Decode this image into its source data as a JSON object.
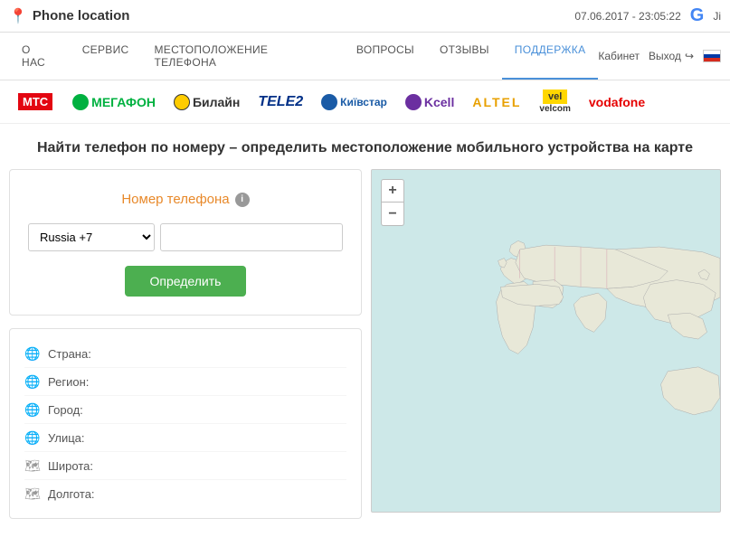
{
  "header": {
    "logo_text": "Phone location",
    "datetime": "07.06.2017 - 23:05:22",
    "google_label": "G Ji"
  },
  "nav": {
    "items": [
      {
        "id": "about",
        "label": "О НАС"
      },
      {
        "id": "service",
        "label": "СЕРВИС"
      },
      {
        "id": "location",
        "label": "МЕСТОПОЛОЖЕНИЕ ТЕЛЕФОНА"
      },
      {
        "id": "questions",
        "label": "ВОПРОСЫ"
      },
      {
        "id": "reviews",
        "label": "ОТЗЫВЫ"
      },
      {
        "id": "support",
        "label": "ПОДДЕРЖКА",
        "active": true
      }
    ],
    "cabinet_label": "Кабинет",
    "logout_label": "Выход"
  },
  "brands": [
    {
      "id": "mts",
      "label": "МТС"
    },
    {
      "id": "megafon",
      "label": "МЕГАФОН"
    },
    {
      "id": "beeline",
      "label": "Билайн"
    },
    {
      "id": "tele2",
      "label": "TELE2"
    },
    {
      "id": "kyivstar",
      "label": "Київстар"
    },
    {
      "id": "kcell",
      "label": "Kcell"
    },
    {
      "id": "altel",
      "label": "ALTEL"
    },
    {
      "id": "velcom",
      "label": "velcom"
    },
    {
      "id": "vodafone",
      "label": "vodafone"
    }
  ],
  "main": {
    "heading": "Найти телефон по номеру – определить местоположение мобильного устройства на карте",
    "phone_label": "Номер телефона",
    "country_default": "Russia +7",
    "phone_placeholder": "",
    "locate_button": "Определить",
    "map_zoom_in": "+",
    "map_zoom_out": "−"
  },
  "info_fields": [
    {
      "id": "country",
      "label": "Страна:",
      "icon": "globe"
    },
    {
      "id": "region",
      "label": "Регион:",
      "icon": "globe"
    },
    {
      "id": "city",
      "label": "Город:",
      "icon": "globe"
    },
    {
      "id": "street",
      "label": "Улица:",
      "icon": "globe"
    },
    {
      "id": "latitude",
      "label": "Широта:",
      "icon": "map"
    },
    {
      "id": "longitude",
      "label": "Долгота:",
      "icon": "map"
    }
  ],
  "colors": {
    "accent": "#4a90d9",
    "green": "#4caf50",
    "orange": "#e8892a",
    "mts_red": "#e30611",
    "megafon_green": "#00b140",
    "tele2_blue": "#003087",
    "nav_active": "#4a90d9"
  }
}
